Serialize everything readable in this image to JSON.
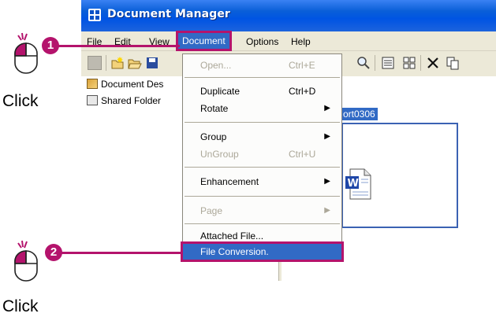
{
  "window": {
    "title": "Document Manager"
  },
  "menubar": {
    "items": [
      "File",
      "Edit",
      "View",
      "Document",
      "Options",
      "Help"
    ]
  },
  "tree": {
    "items": [
      "Document Des",
      "Shared Folder"
    ]
  },
  "right_pane": {
    "selected_label": "ort0306"
  },
  "document_menu": {
    "items": [
      {
        "label": "Open...",
        "shortcut": "Ctrl+E"
      },
      {
        "label": "Duplicate",
        "shortcut": "Ctrl+D"
      },
      {
        "label": "Rotate",
        "submenu": "▶"
      },
      {
        "label": "Group",
        "submenu": "▶"
      },
      {
        "label": "UnGroup",
        "shortcut": "Ctrl+U"
      },
      {
        "label": "Enhancement",
        "submenu": "▶"
      },
      {
        "label": "Page",
        "submenu": "▶"
      },
      {
        "label": "Attached File..."
      },
      {
        "label": "File Conversion."
      }
    ]
  },
  "annotations": {
    "step1": "1",
    "step2": "2",
    "click1": "Click",
    "click2": "Click",
    "accent_color": "#b4136c"
  },
  "icons": {
    "app": "grid-app-icon",
    "mouse": "mouse-click-icon",
    "document": "word-document-icon"
  }
}
